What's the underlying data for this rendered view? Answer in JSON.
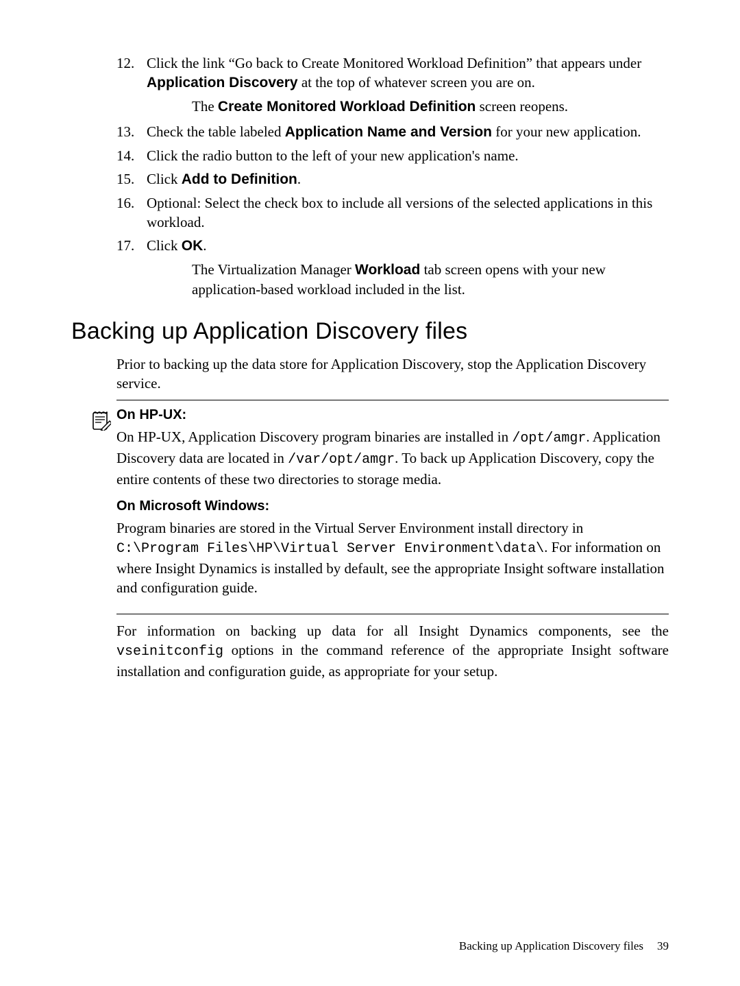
{
  "steps": {
    "s12_num": "12.",
    "s12_a": "Click the link “Go back to Create Monitored Workload Definition” that appears under ",
    "s12_b": "Application Discovery",
    "s12_c": " at the top of whatever screen you are on.",
    "s12_sub_a": "The ",
    "s12_sub_b": "Create Monitored Workload Definition",
    "s12_sub_c": " screen reopens.",
    "s13_num": "13.",
    "s13_a": "Check the table labeled ",
    "s13_b": "Application Name and Version",
    "s13_c": " for your new application.",
    "s14_num": "14.",
    "s14": "Click the radio button to the left of your new application's name.",
    "s15_num": "15.",
    "s15_a": "Click ",
    "s15_b": "Add to Definition",
    "s15_c": ".",
    "s16_num": "16.",
    "s16": "Optional: Select the check box to include all versions of the selected applications in this workload.",
    "s17_num": "17.",
    "s17_a": "Click ",
    "s17_b": "OK",
    "s17_c": ".",
    "s17_sub_a": "The Virtualization Manager ",
    "s17_sub_b": "Workload",
    "s17_sub_c": " tab screen opens with your new application-based workload included in the list."
  },
  "section_title": "Backing up Application Discovery files",
  "intro": "Prior to backing up the data store for Application Discovery, stop the Application Discovery service.",
  "hpux": {
    "heading": "On HP-UX:",
    "p1": "On HP-UX, Application Discovery program binaries are installed in ",
    "path1": "/opt/amgr",
    "p2": ". Application Discovery data are located in ",
    "path2": "/var/opt/amgr",
    "p3": ". To back up Application Discovery, copy the entire contents of these two directories to storage media."
  },
  "win": {
    "heading": "On Microsoft Windows:",
    "p1": "Program binaries are stored in the Virtual Server Environment install directory in ",
    "path": "C:\\Program Files\\HP\\Virtual Server Environment\\data\\",
    "p2": ". For information on where Insight Dynamics is installed by default, see the appropriate Insight software installation and configuration guide."
  },
  "after": {
    "p1": "For information on backing up data for all Insight Dynamics components, see the ",
    "cmd": "vseinitconfig",
    "p2": " options in the command reference of the appropriate Insight software installation and configuration guide, as appropriate for your setup."
  },
  "footer": {
    "text": "Backing up Application Discovery files",
    "page": "39"
  }
}
